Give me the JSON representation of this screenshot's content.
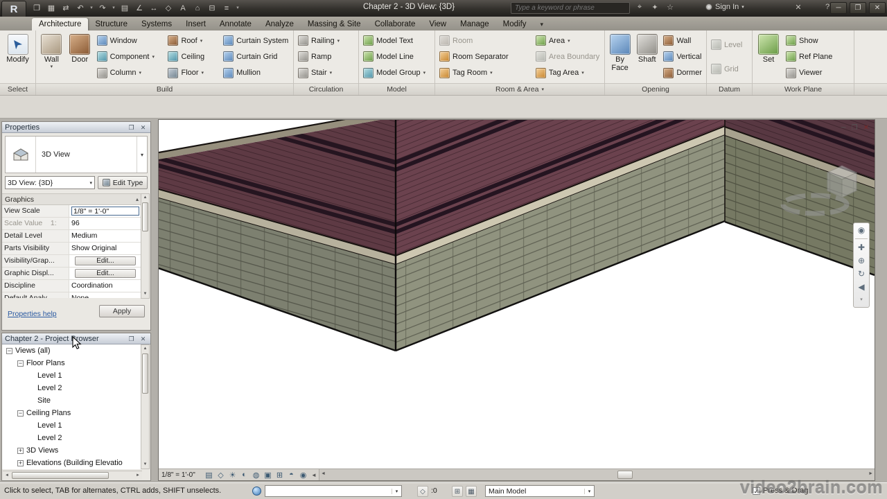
{
  "glyphs": {
    "app_r": "R",
    "caret": "▾",
    "open": "❐",
    "save": "▦",
    "sync": "⇄",
    "undo": "↶",
    "redo": "↷",
    "print": "▤",
    "measure": "∠",
    "dimension": "↔",
    "tag": "◇",
    "text": "A",
    "home3d": "⌂",
    "section": "⊟",
    "thin_lines": "≡",
    "binoculars": "⌖",
    "spark": "✦",
    "star": "☆",
    "help": "?",
    "exchange": "✕",
    "win_min": "─",
    "win_restore": "❐",
    "win_close": "✕",
    "detail_level": "▤",
    "visual_style": "◇",
    "sun": "☀",
    "shadows": "◐",
    "render": "◍",
    "crop": "▣",
    "show_crop": "⊞",
    "temp_hide": "◓",
    "reveal": "◉",
    "wheel": "◉",
    "pan": "✚",
    "zoom": "⊕",
    "orbit": "↻",
    "rewind": "◀",
    "scroll_up": "▲",
    "scroll_down": "▼",
    "scroll_left": "◄",
    "scroll_right": "►",
    "section_collapse": "▴",
    "check": "✓",
    "editable": "⊞",
    "options": "▦"
  },
  "titlebar": {
    "title": "Chapter 2 - 3D View: {3D}",
    "search_placeholder": "Type a keyword or phrase",
    "sign_in": "Sign In"
  },
  "tabs": {
    "items": [
      "Architecture",
      "Structure",
      "Systems",
      "Insert",
      "Annotate",
      "Analyze",
      "Massing & Site",
      "Collaborate",
      "View",
      "Manage",
      "Modify"
    ]
  },
  "ribbon": {
    "select": {
      "modify": "Modify",
      "panel": "Select"
    },
    "build": {
      "wall": "Wall",
      "door": "Door",
      "window": "Window",
      "component": "Component",
      "column": "Column",
      "roof": "Roof",
      "ceiling": "Ceiling",
      "floor": "Floor",
      "curtain_system": "Curtain System",
      "curtain_grid": "Curtain Grid",
      "mullion": "Mullion",
      "panel": "Build"
    },
    "circulation": {
      "railing": "Railing",
      "ramp": "Ramp",
      "stair": "Stair",
      "panel": "Circulation"
    },
    "model": {
      "text": "Model Text",
      "line": "Model Line",
      "group": "Model Group",
      "panel": "Model"
    },
    "room_area": {
      "room": "Room",
      "room_separator": "Room Separator",
      "tag_room": "Tag Room",
      "area": "Area",
      "area_boundary": "Area Boundary",
      "tag_area": "Tag Area",
      "panel": "Room & Area"
    },
    "opening": {
      "by_face": "By Face",
      "shaft": "Shaft",
      "wall": "Wall",
      "vertical": "Vertical",
      "dormer": "Dormer",
      "panel": "Opening"
    },
    "datum": {
      "level": "Level",
      "grid": "Grid",
      "panel": "Datum"
    },
    "work_plane": {
      "set": "Set",
      "show": "Show",
      "ref_plane": "Ref Plane",
      "viewer": "Viewer",
      "panel": "Work Plane"
    }
  },
  "properties": {
    "header": "Properties",
    "type_name": "3D View",
    "selector": "3D View: {3D}",
    "edit_type": "Edit Type",
    "section": "Graphics",
    "rows": [
      {
        "label": "View Scale",
        "value": "1/8\" = 1'-0\""
      },
      {
        "label": "Scale Value    1:",
        "value": "96"
      },
      {
        "label": "Detail Level",
        "value": "Medium"
      },
      {
        "label": "Parts Visibility",
        "value": "Show Original"
      },
      {
        "label": "Visibility/Grap...",
        "value": "Edit..."
      },
      {
        "label": "Graphic Displ...",
        "value": "Edit..."
      },
      {
        "label": "Discipline",
        "value": "Coordination"
      },
      {
        "label": "Default Analy...",
        "value": "None"
      }
    ],
    "help": "Properties help",
    "apply": "Apply"
  },
  "browser": {
    "header": "Chapter 2 - Project Browser",
    "items": [
      {
        "label": "Views (all)"
      },
      {
        "label": "Floor Plans"
      },
      {
        "label": "Level 1"
      },
      {
        "label": "Level 2"
      },
      {
        "label": "Site"
      },
      {
        "label": "Ceiling Plans"
      },
      {
        "label": "Level 1"
      },
      {
        "label": "Level 2"
      },
      {
        "label": "3D Views"
      },
      {
        "label": "Elevations (Building Elevatio"
      }
    ]
  },
  "viewport": {
    "scale": "1/8\" = 1'-0\""
  },
  "statusbar": {
    "message": "Click to select, TAB for alternates, CTRL adds, SHIFT unselects.",
    "exclude_count": ":0",
    "main_model": "Main Model",
    "press_drag": "Press & Drag",
    "watermark": "video2brain.com"
  },
  "colors": {
    "brick": "#6a414c",
    "brick_band": "#241419",
    "stone_band": "#ccc6b0",
    "cmu": "#8e9180",
    "accent_blue": "#3a6aa8",
    "titlebar": "#3a3733"
  }
}
